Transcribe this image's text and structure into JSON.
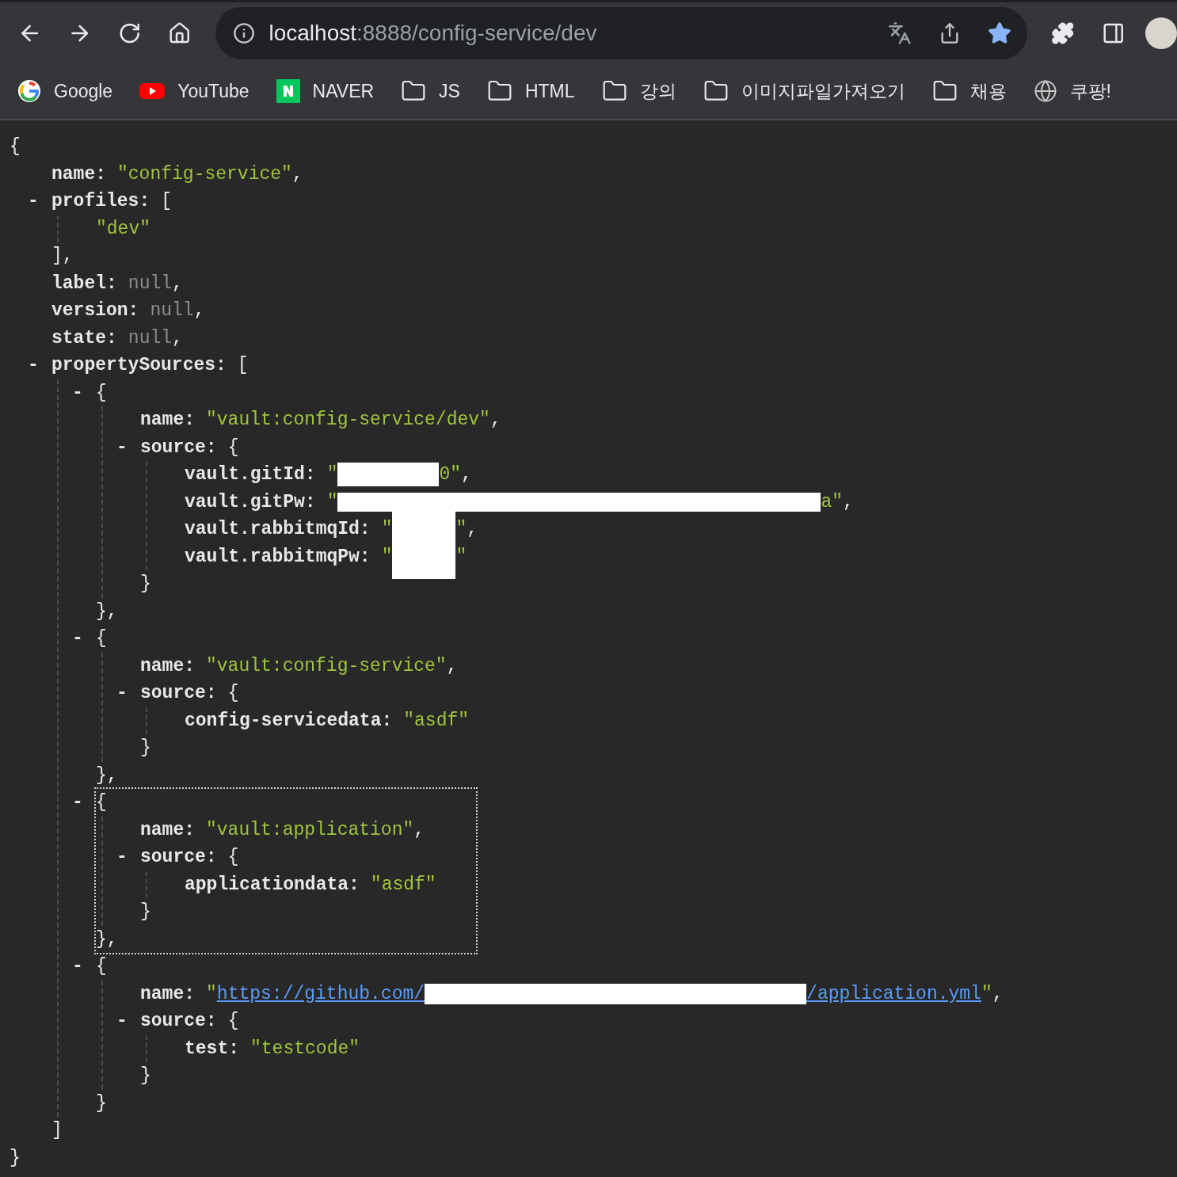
{
  "address_bar": {
    "host": "localhost",
    "path": ":8888/config-service/dev",
    "bookmarked": true
  },
  "bookmarks": [
    {
      "label": "Google",
      "kind": "google"
    },
    {
      "label": "YouTube",
      "kind": "youtube"
    },
    {
      "label": "NAVER",
      "kind": "naver"
    },
    {
      "label": "JS",
      "kind": "folder"
    },
    {
      "label": "HTML",
      "kind": "folder"
    },
    {
      "label": "강의",
      "kind": "folder"
    },
    {
      "label": "이미지파일가져오기",
      "kind": "folder"
    },
    {
      "label": "채용",
      "kind": "folder"
    },
    {
      "label": "쿠팡!",
      "kind": "globe"
    }
  ],
  "document": {
    "kind": "object",
    "open": "{",
    "close": "}",
    "children": [
      {
        "key": "name:",
        "kind": "string",
        "parts": [
          {
            "kind": "text",
            "text": "\"config-service\""
          }
        ],
        "punct": ","
      },
      {
        "key": "profiles:",
        "kind": "array",
        "toggle": "-",
        "expanded": true,
        "focused": false,
        "open": "[",
        "close": "],",
        "children": [
          {
            "kind": "string",
            "parts": [
              {
                "kind": "text",
                "text": "\"dev\""
              }
            ]
          }
        ]
      },
      {
        "key": "label:",
        "kind": "null",
        "parts": [
          {
            "kind": "text",
            "text": "null"
          }
        ],
        "punct": ","
      },
      {
        "key": "version:",
        "kind": "null",
        "parts": [
          {
            "kind": "text",
            "text": "null"
          }
        ],
        "punct": ","
      },
      {
        "key": "state:",
        "kind": "null",
        "parts": [
          {
            "kind": "text",
            "text": "null"
          }
        ],
        "punct": ","
      },
      {
        "key": "propertySources:",
        "kind": "array",
        "toggle": "-",
        "expanded": true,
        "focused": false,
        "open": "[",
        "close": "]",
        "children": [
          {
            "kind": "object",
            "toggle": "-",
            "expanded": true,
            "focused": false,
            "open": "{",
            "close": "},",
            "children": [
              {
                "key": "name:",
                "kind": "string",
                "parts": [
                  {
                    "kind": "text",
                    "text": "\"vault:config-service/dev\""
                  }
                ],
                "punct": ","
              },
              {
                "key": "source:",
                "kind": "object",
                "toggle": "-",
                "expanded": true,
                "focused": false,
                "open": "{",
                "close": "}",
                "children": [
                  {
                    "key": "vault.gitId:",
                    "kind": "string",
                    "parts": [
                      {
                        "kind": "text",
                        "text": "\""
                      },
                      {
                        "kind": "mask"
                      },
                      {
                        "kind": "text",
                        "text": "0\""
                      }
                    ],
                    "punct": ","
                  },
                  {
                    "key": "vault.gitPw:",
                    "kind": "string",
                    "parts": [
                      {
                        "kind": "text",
                        "text": "\""
                      },
                      {
                        "kind": "widemask"
                      },
                      {
                        "kind": "text",
                        "text": "a\""
                      }
                    ],
                    "punct": ","
                  },
                  {
                    "key": "vault.rabbitmqId:",
                    "kind": "string",
                    "parts": [
                      {
                        "kind": "text",
                        "text": "\""
                      },
                      {
                        "kind": "tallmask"
                      },
                      {
                        "kind": "text",
                        "text": "\""
                      }
                    ],
                    "punct": ","
                  },
                  {
                    "key": "vault.rabbitmqPw:",
                    "kind": "string",
                    "parts": [
                      {
                        "kind": "text",
                        "text": "\""
                      },
                      {
                        "kind": "tallmask"
                      },
                      {
                        "kind": "text",
                        "text": "\""
                      }
                    ]
                  }
                ]
              }
            ]
          },
          {
            "kind": "object",
            "toggle": "-",
            "expanded": true,
            "focused": false,
            "open": "{",
            "close": "},",
            "children": [
              {
                "key": "name:",
                "kind": "string",
                "parts": [
                  {
                    "kind": "text",
                    "text": "\"vault:config-service\""
                  }
                ],
                "punct": ","
              },
              {
                "key": "source:",
                "kind": "object",
                "toggle": "-",
                "expanded": true,
                "focused": false,
                "open": "{",
                "close": "}",
                "children": [
                  {
                    "key": "config-servicedata:",
                    "kind": "string",
                    "parts": [
                      {
                        "kind": "text",
                        "text": "\"asdf\""
                      }
                    ]
                  }
                ]
              }
            ]
          },
          {
            "kind": "object",
            "toggle": "-",
            "expanded": true,
            "focused": true,
            "open": "{",
            "close": "},",
            "children": [
              {
                "key": "name:",
                "kind": "string",
                "parts": [
                  {
                    "kind": "text",
                    "text": "\"vault:application\""
                  }
                ],
                "punct": ","
              },
              {
                "key": "source:",
                "kind": "object",
                "toggle": "-",
                "expanded": true,
                "focused": false,
                "open": "{",
                "close": "}",
                "children": [
                  {
                    "key": "applicationdata:",
                    "kind": "string",
                    "parts": [
                      {
                        "kind": "text",
                        "text": "\"asdf\""
                      }
                    ]
                  }
                ]
              }
            ]
          },
          {
            "kind": "object",
            "toggle": "-",
            "expanded": true,
            "focused": false,
            "open": "{",
            "close": "}",
            "children": [
              {
                "key": "name:",
                "kind": "string",
                "parts": [
                  {
                    "kind": "text",
                    "text": "\""
                  },
                  {
                    "kind": "link",
                    "text": "https://github.com/"
                  },
                  {
                    "kind": "longmask"
                  },
                  {
                    "kind": "link",
                    "text": "/application.yml"
                  },
                  {
                    "kind": "text",
                    "text": "\""
                  }
                ],
                "punct": ","
              },
              {
                "key": "source:",
                "kind": "object",
                "toggle": "-",
                "expanded": true,
                "focused": false,
                "open": "{",
                "close": "}",
                "children": [
                  {
                    "key": "test:",
                    "kind": "string",
                    "parts": [
                      {
                        "kind": "text",
                        "text": "\"testcode\""
                      }
                    ]
                  }
                ]
              }
            ]
          }
        ]
      }
    ]
  }
}
